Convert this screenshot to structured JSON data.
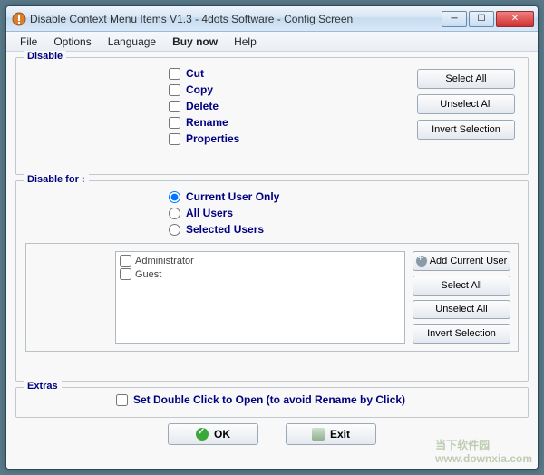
{
  "window": {
    "title": "Disable Context Menu Items V1.3 - 4dots Software - Config Screen"
  },
  "menu": {
    "file": "File",
    "options": "Options",
    "language": "Language",
    "buynow": "Buy now",
    "help": "Help"
  },
  "groups": {
    "disable": "Disable",
    "disable_for": "Disable for :",
    "extras": "Extras"
  },
  "disable_items": {
    "cut": "Cut",
    "copy": "Copy",
    "delete": "Delete",
    "rename": "Rename",
    "properties": "Properties"
  },
  "disable_buttons": {
    "select_all": "Select All",
    "unselect_all": "Unselect All",
    "invert": "Invert Selection"
  },
  "disable_for": {
    "current": "Current User Only",
    "all": "All Users",
    "selected": "Selected Users"
  },
  "users": {
    "admin": "Administrator",
    "guest": "Guest"
  },
  "user_buttons": {
    "add_current": "Add Current User",
    "select_all": "Select All",
    "unselect_all": "Unselect All",
    "invert": "Invert Selection"
  },
  "extras": {
    "double_click": "Set Double Click to Open (to avoid Rename by Click)"
  },
  "footer": {
    "ok": "OK",
    "exit": "Exit"
  },
  "watermark": {
    "site": "www.downxia.com",
    "brand": "当下软件园"
  }
}
